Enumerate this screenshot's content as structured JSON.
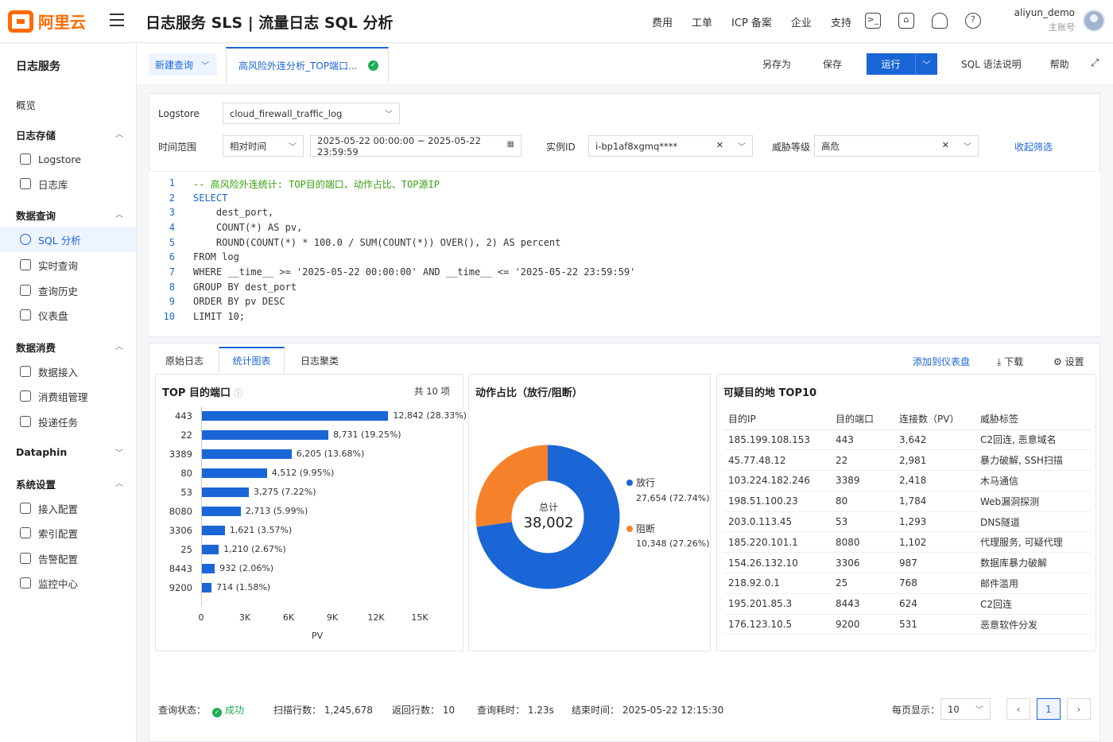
{
  "brand": {
    "name": "阿里云",
    "color": "#ff6a00"
  },
  "header": {
    "title": "日志服务 SLS | 流量日志 SQL 分析",
    "nav": [
      "费用",
      "工单",
      "ICP 备案",
      "企业",
      "支持"
    ],
    "icons": [
      "terminal-icon",
      "store-icon",
      "bell-icon",
      "help-icon"
    ],
    "user": {
      "name": "aliyun_demo",
      "role": "主账号"
    }
  },
  "sidebar": {
    "title": "日志服务",
    "overview": "概览",
    "groups": [
      {
        "label": "日志存储",
        "items": [
          "Logstore",
          "日志库"
        ]
      },
      {
        "label": "数据查询",
        "items": [
          "SQL 分析",
          "实时查询",
          "查询历史",
          "仪表盘"
        ]
      },
      {
        "label": "数据消费",
        "items": [
          "数据接入",
          "消费组管理",
          "投递任务"
        ]
      },
      {
        "label": "Dataphin",
        "items": []
      },
      {
        "label": "系统设置",
        "items": [
          "接入配置",
          "索引配置",
          "告警配置",
          "监控中心"
        ]
      }
    ],
    "active_item": "SQL 分析"
  },
  "tabs": {
    "new_query": "新建查询",
    "active_tab": "高风险外连分析_TOP端口...",
    "save_as": "另存为",
    "save": "保存",
    "run": "运行",
    "sql_help": "SQL 语法说明",
    "help": "帮助"
  },
  "filters": {
    "logstore_label": "Logstore",
    "logstore_value": "cloud_firewall_traffic_log",
    "time_label": "时间范围",
    "time_mode": "相对时间",
    "time_range": "2025-05-22 00:00:00 ~ 2025-05-22 23:59:59",
    "instance_label": "实例ID",
    "instance_value": "i-bp1af8xgmq****",
    "threat_label": "威胁等级",
    "threat_value": "高危",
    "collapse": "收起筛选"
  },
  "editor": {
    "lines": [
      "-- 高风险外连统计: TOP目的端口、动作占比、TOP源IP",
      "SELECT",
      "    dest_port,",
      "    COUNT(*) AS pv,",
      "    ROUND(COUNT(*) * 100.0 / SUM(COUNT(*)) OVER(), 2) AS percent",
      "FROM log",
      "WHERE __time__ >= '2025-05-22 00:00:00' AND __time__ <= '2025-05-22 23:59:59'",
      "GROUP BY dest_port",
      "ORDER BY pv DESC",
      "LIMIT 10;"
    ]
  },
  "results": {
    "tabs": [
      "原始日志",
      "统计图表",
      "日志聚类"
    ],
    "active_tab": "统计图表",
    "add_dashboard": "添加到仪表盘",
    "download": "下载",
    "settings": "设置"
  },
  "chart_data": [
    {
      "type": "bar",
      "title": "TOP 目的端口",
      "count_label": "共 10 项",
      "orientation": "horizontal",
      "categories": [
        "443",
        "22",
        "3389",
        "80",
        "53",
        "8080",
        "3306",
        "25",
        "8443",
        "9200"
      ],
      "values": [
        12842,
        8731,
        6205,
        4512,
        3275,
        2713,
        1621,
        1210,
        932,
        714
      ],
      "data_labels": [
        "12,842 (28.33%)",
        "8,731 (19.25%)",
        "6,205 (13.68%)",
        "4,512 (9.95%)",
        "3,275 (7.22%)",
        "2,713 (5.99%)",
        "1,621 (3.57%)",
        "1,210 (2.67%)",
        "932 (2.06%)",
        "714 (1.58%)"
      ],
      "xlabel": "PV",
      "x_ticks": [
        "0",
        "3K",
        "6K",
        "9K",
        "12K",
        "15K"
      ],
      "xlim": [
        0,
        15000
      ],
      "color": "#1a66d6"
    },
    {
      "type": "pie",
      "title": "动作占比（放行/阻断）",
      "center_label": "总计",
      "center_value": "38,002",
      "categories": [
        "放行",
        "阻断"
      ],
      "values": [
        27654,
        10348
      ],
      "value_labels": [
        "27,654 (72.74%)",
        "10,348 (27.26%)"
      ],
      "colors": [
        "#1a66d6",
        "#f5822a"
      ],
      "legend": "right"
    },
    {
      "type": "table",
      "title": "可疑目的地 TOP10",
      "columns": [
        "目的IP",
        "目的端口",
        "连接数（PV）",
        "威胁标签"
      ],
      "rows": [
        [
          "185.199.108.153",
          "443",
          "3,642",
          "C2回连, 恶意域名"
        ],
        [
          "45.77.48.12",
          "22",
          "2,981",
          "暴力破解, SSH扫描"
        ],
        [
          "103.224.182.246",
          "3389",
          "2,418",
          "木马通信"
        ],
        [
          "198.51.100.23",
          "80",
          "1,784",
          "Web漏洞探测"
        ],
        [
          "203.0.113.45",
          "53",
          "1,293",
          "DNS隧道"
        ],
        [
          "185.220.101.1",
          "8080",
          "1,102",
          "代理服务, 可疑代理"
        ],
        [
          "154.26.132.10",
          "3306",
          "987",
          "数据库暴力破解"
        ],
        [
          "218.92.0.1",
          "25",
          "768",
          "邮件滥用"
        ],
        [
          "195.201.85.3",
          "8443",
          "624",
          "C2回连"
        ],
        [
          "176.123.10.5",
          "9200",
          "531",
          "恶意软件分发"
        ]
      ]
    }
  ],
  "status": {
    "state_label": "查询状态：",
    "state_value": "成功",
    "scanned": "扫描行数：  1,245,678",
    "returned": "返回行数：  10",
    "elapsed": "查询耗时：  1.23s",
    "finished": "结束时间：  2025-05-22 12:15:30",
    "page_size_label": "每页显示：",
    "page_size": "10",
    "page": "1"
  }
}
